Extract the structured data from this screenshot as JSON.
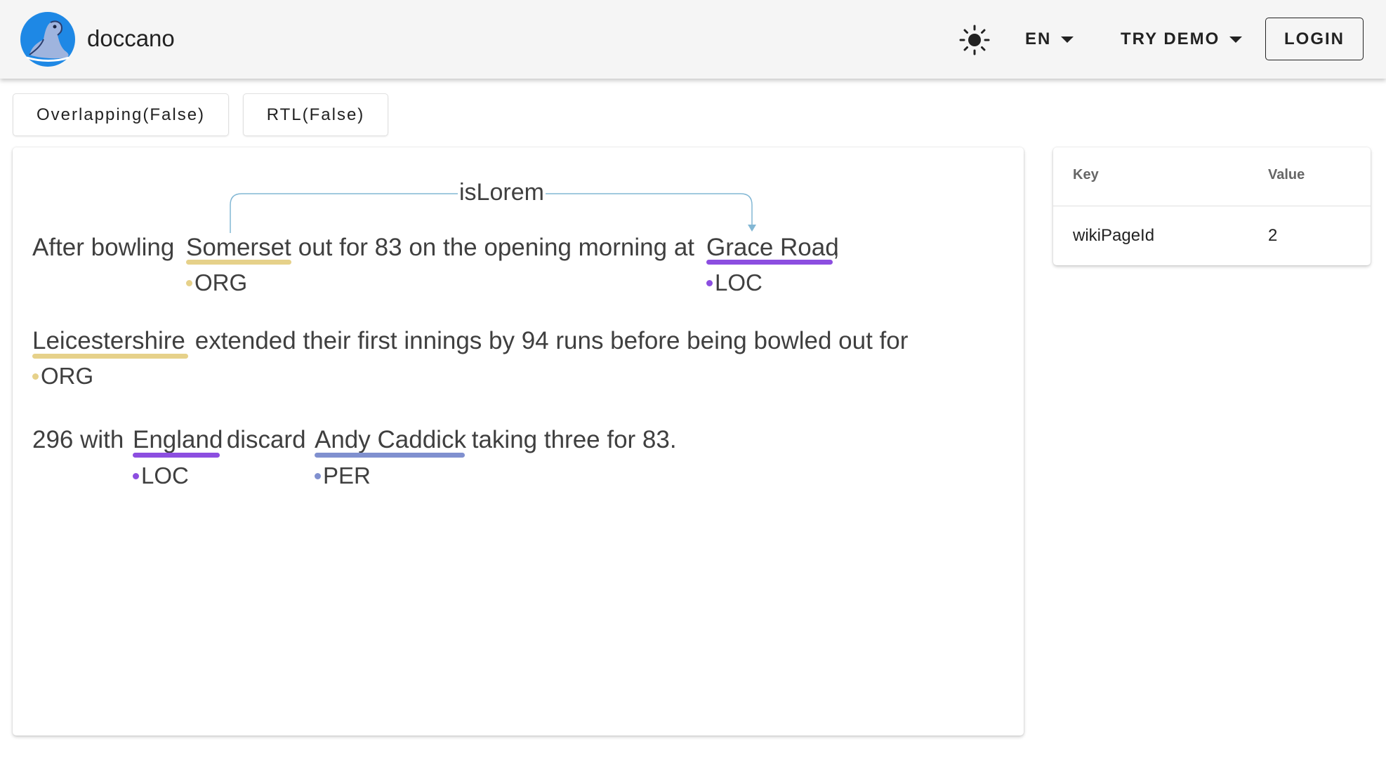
{
  "app": {
    "brand": "doccano",
    "logo_icon": "seal-logo-icon"
  },
  "header": {
    "theme_icon": "sun-icon",
    "language": "EN",
    "try_demo": "TRY DEMO",
    "login": "LOGIN"
  },
  "toolbar": {
    "overlapping": "Overlapping(False)",
    "rtl": "RTL(False)"
  },
  "colors": {
    "ORG": "#e6d18a",
    "LOC": "#8c4ee0",
    "PER": "#8090cf",
    "relation": "#82b7d4"
  },
  "document": {
    "lines": [
      {
        "segments": [
          {
            "text": "After bowling "
          },
          {
            "text": "Somerset",
            "label": "ORG"
          },
          {
            "text": " out for 83 on the opening morning at "
          },
          {
            "text": "Grace Road",
            "label": "LOC"
          },
          {
            "text": ","
          }
        ]
      },
      {
        "segments": [
          {
            "text": "Leicestershire",
            "label": "ORG"
          },
          {
            "text": " extended their first innings by 94 runs before being bowled out for"
          }
        ]
      },
      {
        "segments": [
          {
            "text": "296 with "
          },
          {
            "text": "England",
            "label": "LOC"
          },
          {
            "text": " discard "
          },
          {
            "text": "Andy Caddick",
            "label": "PER"
          },
          {
            "text": " taking three for 83."
          }
        ]
      }
    ],
    "relations": [
      {
        "label": "isLorem",
        "from": "Somerset",
        "to": "Grace Road"
      }
    ]
  },
  "metadata": {
    "key_header": "Key",
    "value_header": "Value",
    "rows": [
      {
        "key": "wikiPageId",
        "value": "2"
      }
    ]
  }
}
